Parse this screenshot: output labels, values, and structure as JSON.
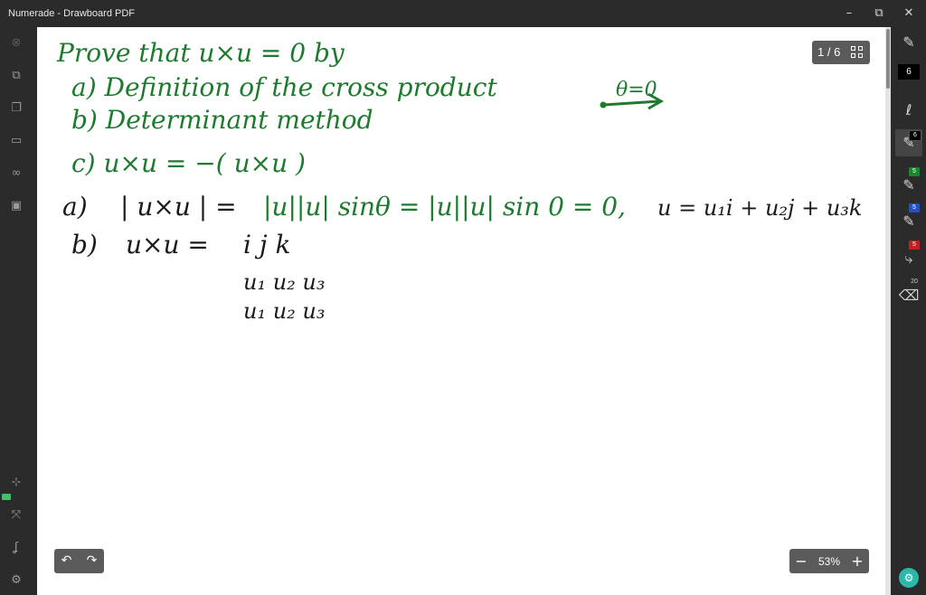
{
  "window": {
    "title": "Numerade - Drawboard PDF",
    "controls": {
      "minimize": "–",
      "maximize": "⧉",
      "close": "✕"
    }
  },
  "left_rail": {
    "icons": [
      "close-circle-icon",
      "layers-icon",
      "copy-icon",
      "keyboard-icon",
      "binoculars-icon",
      "save-icon",
      "ruler-icon",
      "fit-screen-icon",
      "lasso-icon",
      "settings-icon"
    ]
  },
  "page": {
    "current": "1 / 6"
  },
  "zoom": {
    "value": "53%",
    "minus": "−",
    "plus": "+"
  },
  "toolbar": {
    "pen_size": "6",
    "tools": [
      {
        "name": "pen",
        "badge": "6",
        "badge_color": "#000000"
      },
      {
        "name": "pen-green",
        "badge": "5",
        "badge_color": "#16892c"
      },
      {
        "name": "pen-blue",
        "badge": "5",
        "badge_color": "#2150c8"
      },
      {
        "name": "pen-red",
        "badge": "5",
        "badge_color": "#c42020"
      },
      {
        "name": "eraser",
        "badge": "20",
        "badge_color": ""
      }
    ]
  },
  "ink": {
    "line1": "Prove that u×u = 0 by",
    "line2": "a) Definition of the cross product",
    "line3": "b) Determinant method",
    "line4": "c)  u×u = −( u×u )",
    "side_note": "θ=0",
    "line5_a": "a)",
    "line5_expr": "| u×u | =",
    "line5_green": "|u||u| sinθ = |u||u| sin 0 = 0,",
    "line5_vec": "u = u₁i + u₂j + u₃k",
    "line6_b": "b)",
    "line6_expr": "u×u =",
    "det_row1": "i  j  k",
    "det_row2": "u₁ u₂ u₃",
    "det_row3": "u₁ u₂ u₃"
  },
  "colors": {
    "ink_green": "#1e7a2e",
    "ink_black": "#1a1a1a",
    "accent_teal": "#2bb8a8"
  }
}
